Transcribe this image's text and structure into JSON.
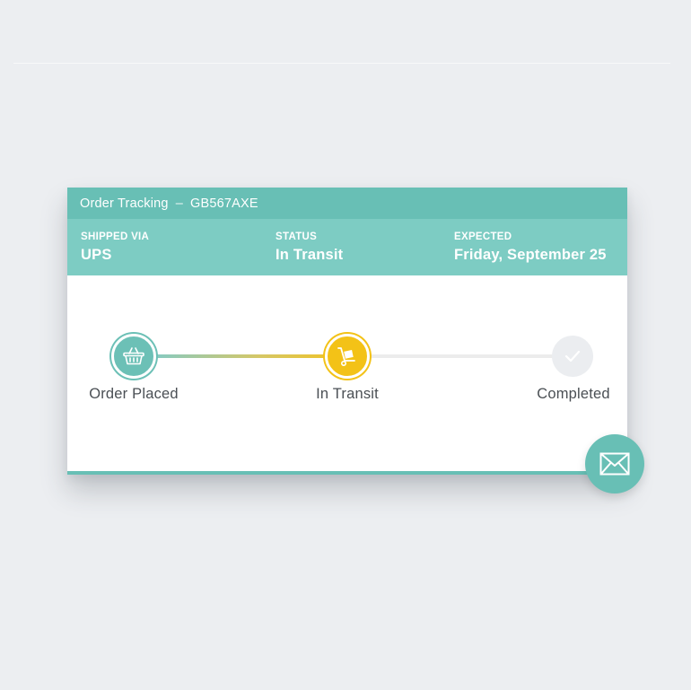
{
  "order": {
    "title": "Order Tracking",
    "separator": "–",
    "tracking_number": "GB567AXE"
  },
  "info": {
    "shipped_via": {
      "label": "SHIPPED VIA",
      "value": "UPS"
    },
    "status": {
      "label": "STATUS",
      "value": "In Transit"
    },
    "expected": {
      "label": "EXPECTED",
      "value": "Friday, September 25"
    }
  },
  "steps": [
    {
      "label": "Order Placed",
      "icon": "basket-icon",
      "state": "done"
    },
    {
      "label": "In Transit",
      "icon": "hand-truck-icon",
      "state": "current"
    },
    {
      "label": "Completed",
      "icon": "check-icon",
      "state": "pending"
    }
  ],
  "actions": {
    "message_icon": "envelope-icon"
  },
  "colors": {
    "teal_dark": "#68bfb5",
    "teal_light": "#7dccc3",
    "accent_yellow": "#f3c217",
    "pending_gray": "#ebedf0",
    "background": "#eceef1"
  }
}
